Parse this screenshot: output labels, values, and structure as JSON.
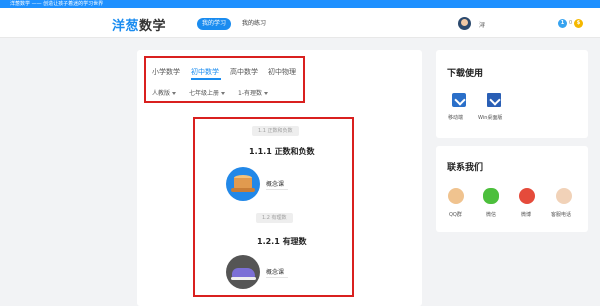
{
  "titlebar": {
    "text": "洋葱数学 —— 创造让孩子着迷的学习世界"
  },
  "header": {
    "brand_main": "洋葱",
    "brand_accent": "数学",
    "nav": [
      {
        "label": "我的学习",
        "active": true
      },
      {
        "label": "我的练习",
        "active": false
      }
    ],
    "username": "浔",
    "coin_blue": "1",
    "coin_count": "0",
    "coin_gold": "$"
  },
  "tabs": [
    "小学数学",
    "初中数学",
    "高中数学",
    "初中物理"
  ],
  "active_tab": "初中数学",
  "filters": [
    "人教版",
    "七年级上册",
    "1-有理数"
  ],
  "sections": [
    {
      "badge": "1.1 正数和负数",
      "title": "1.1.1 正数和负数",
      "lesson": "概念课",
      "icon": "tree-stump-icon"
    },
    {
      "badge": "1.2 有理数",
      "title": "1.2.1 有理数",
      "lesson": "概念课",
      "icon": "sneaker-icon"
    }
  ],
  "download": {
    "title": "下载使用",
    "items": [
      {
        "label": "移动端",
        "icon": "mobile-download-icon"
      },
      {
        "label": "Win桌面版",
        "icon": "windows-download-icon"
      }
    ]
  },
  "contact": {
    "title": "联系我们",
    "items": [
      {
        "label": "QQ群",
        "icon": "qq-icon"
      },
      {
        "label": "微信",
        "icon": "wechat-icon"
      },
      {
        "label": "微博",
        "icon": "weibo-icon"
      },
      {
        "label": "客服电话",
        "icon": "customer-service-icon"
      }
    ]
  },
  "colors": {
    "primary": "#1a8cf0",
    "highlight_box": "#d9201f",
    "titlebar": "#1e90ff"
  }
}
